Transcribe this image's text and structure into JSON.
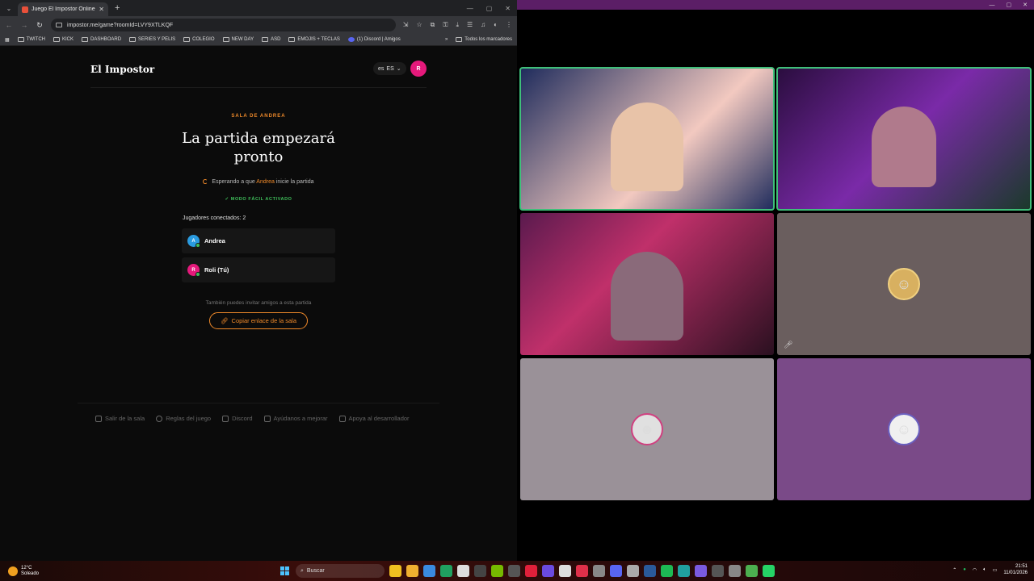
{
  "browser": {
    "tab_title": "Juego El Impostor Online - Jueg",
    "url": "impostor.me/game?roomId=LVY9XTLKQF",
    "bookmarks": [
      "TWITCH",
      "KICK",
      "DASHBOARD",
      "SERIES Y PELIS",
      "COLEGIO",
      "NEW DAY",
      "ASD",
      "EMOJIS + TECLAS",
      "(1) Discord | Amigos"
    ],
    "all_bookmarks": "Todos los marcadores"
  },
  "site": {
    "logo": "El Impostor",
    "lang": "ES",
    "lang_prefix": "es",
    "user_initial": "R",
    "room_label": "SALA DE ANDREA",
    "headline": "La partida empezará pronto",
    "waiting_prefix": "Esperando a que",
    "waiting_host": "Andrea",
    "waiting_suffix": "inicie la partida",
    "easy_mode": "✓  MODO FÁCIL ACTIVADO",
    "players_title": "Jugadores conectados: 2",
    "players": [
      {
        "initial": "A",
        "name": "Andrea",
        "color": "#2a9be0"
      },
      {
        "initial": "R",
        "name": "Roli (Tú)",
        "color": "#e5197b"
      }
    ],
    "invite_text": "También puedes invitar amigos a esta partida",
    "copy_button": "Copiar enlace de la sala",
    "footer": [
      "Salir de la sala",
      "Reglas del juego",
      "Discord",
      "Ayúdanos a mejorar",
      "Apoya al desarrollador"
    ]
  },
  "call": {
    "tiles": [
      {
        "kind": "video",
        "speaking": true,
        "bg": "#1e2b5c"
      },
      {
        "kind": "video",
        "speaking": true,
        "bg": "#3a1450"
      },
      {
        "kind": "video",
        "speaking": false,
        "bg": "#5a1a4e"
      },
      {
        "kind": "avatar",
        "speaking": false,
        "bg": "#6a5e5e",
        "muted": true
      },
      {
        "kind": "avatar",
        "speaking": false,
        "bg": "#9a9198"
      },
      {
        "kind": "avatar",
        "speaking": false,
        "bg": "#7a4a88"
      }
    ]
  },
  "taskbar": {
    "temp": "12°C",
    "weather": "Soleado",
    "search": "Buscar",
    "time": "21:51",
    "date": "11/01/2026"
  }
}
